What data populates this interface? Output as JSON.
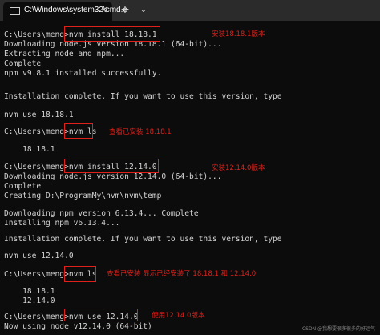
{
  "window": {
    "tab_title": "C:\\Windows\\system32\\cmd.e",
    "close_glyph": "✕",
    "new_tab_glyph": "+",
    "dropdown_glyph": "⌄"
  },
  "console": {
    "lines": [
      "C:\\Users\\meng>nvm install 18.18.1",
      "Downloading node.js version 18.18.1 (64-bit)...",
      "Extracting node and npm...",
      "Complete",
      "npm v9.8.1 installed successfully.",
      "Installation complete. If you want to use this version, type",
      "nvm use 18.18.1",
      "C:\\Users\\meng>nvm ls",
      "    18.18.1",
      "C:\\Users\\meng>nvm install 12.14.0",
      "Downloading node.js version 12.14.0 (64-bit)...",
      "Complete",
      "Creating D:\\ProgramMy\\nvm\\nvm\\temp",
      "Downloading npm version 6.13.4... Complete",
      "Installing npm v6.13.4...",
      "Installation complete. If you want to use this version, type",
      "nvm use 12.14.0",
      "C:\\Users\\meng>nvm ls",
      "    18.18.1",
      "    12.14.0",
      "C:\\Users\\meng>nvm use 12.14.0",
      "Now using node v12.14.0 (64-bit)"
    ]
  },
  "annotations": [
    "安装18.18.1版本",
    "查看已安装 18.18.1",
    "安装12.14.0版本",
    "查看已安装  显示已经安装了 18.18.1 和 12.14.0",
    "使用12.14.0版本"
  ],
  "watermark": "CSDN @我想要很多很多的好运气",
  "colors": {
    "terminal_bg": "#0c0c0c",
    "text": "#d4d4d4",
    "annotation": "#e0201a",
    "titlebar": "#2b2b2b"
  }
}
